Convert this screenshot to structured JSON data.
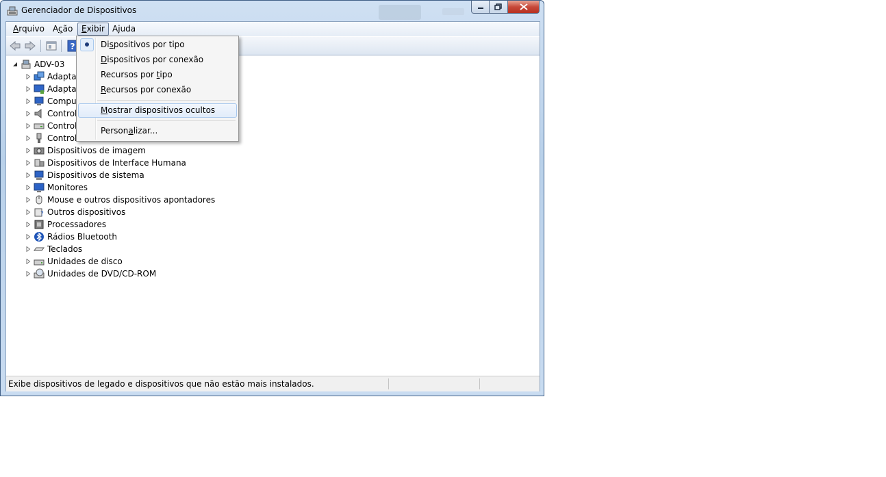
{
  "window": {
    "title": "Gerenciador de Dispositivos",
    "caption_buttons": {
      "minimize": "—",
      "maximize": "□",
      "close": "✕"
    }
  },
  "menubar": {
    "items": [
      {
        "label": "Arquivo",
        "hotkey_index": 0
      },
      {
        "label": "Ação",
        "hotkey_index": 1
      },
      {
        "label": "Exibir",
        "hotkey_index": 0,
        "active": true
      },
      {
        "label": "Ajuda",
        "hotkey_index": 1
      }
    ]
  },
  "toolbar": {
    "icons": [
      "back-arrow-icon",
      "forward-arrow-icon",
      "properties-icon",
      "help-icon"
    ]
  },
  "tree": {
    "root": "ADV-03",
    "children": [
      {
        "label": "Adapta",
        "icon": "network-adapter-icon"
      },
      {
        "label": "Adapta",
        "icon": "display-adapter-icon"
      },
      {
        "label": "Compu",
        "icon": "computer-icon"
      },
      {
        "label": "Control",
        "icon": "sound-controller-icon"
      },
      {
        "label": "Control",
        "icon": "storage-controller-icon"
      },
      {
        "label": "Control",
        "icon": "usb-controller-icon"
      },
      {
        "label": "Dispositivos de imagem",
        "icon": "imaging-device-icon"
      },
      {
        "label": "Dispositivos de Interface Humana",
        "icon": "hid-icon"
      },
      {
        "label": "Dispositivos de sistema",
        "icon": "system-device-icon"
      },
      {
        "label": "Monitores",
        "icon": "monitor-icon"
      },
      {
        "label": "Mouse e outros dispositivos apontadores",
        "icon": "mouse-icon"
      },
      {
        "label": "Outros dispositivos",
        "icon": "unknown-device-icon"
      },
      {
        "label": "Processadores",
        "icon": "processor-icon"
      },
      {
        "label": "Rádios Bluetooth",
        "icon": "bluetooth-icon"
      },
      {
        "label": "Teclados",
        "icon": "keyboard-icon"
      },
      {
        "label": "Unidades de disco",
        "icon": "disk-drive-icon"
      },
      {
        "label": "Unidades de DVD/CD-ROM",
        "icon": "dvd-drive-icon"
      }
    ]
  },
  "dropdown": {
    "items": [
      {
        "label": "Dispositivos por tipo",
        "hotkey_index": 2,
        "checked": true
      },
      {
        "label": "Dispositivos por conexão",
        "hotkey_index": 0
      },
      {
        "label": "Recursos por tipo",
        "hotkey_index": 13
      },
      {
        "label": "Recursos por conexão",
        "hotkey_index": 0
      },
      {
        "label": "Mostrar dispositivos ocultos",
        "hotkey_index": 0,
        "hovered": true
      },
      {
        "label": "Personalizar...",
        "hotkey_index": 5
      }
    ]
  },
  "statusbar": {
    "text": "Exibe dispositivos de legado e dispositivos que não estão mais instalados."
  },
  "colors": {
    "title_gradient": "#b9d1ea",
    "menu_hover_border": "#a8c8ed",
    "close_button": "#c7493a"
  }
}
